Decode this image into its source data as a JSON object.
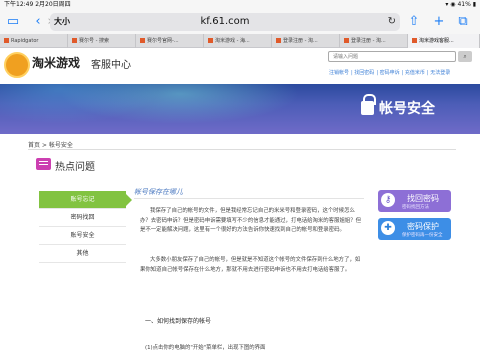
{
  "status_bar": {
    "time": "下午12:49  2月20日周四",
    "battery": "41%"
  },
  "browser": {
    "text_size_label": "大小",
    "host": "kf.61.com",
    "reload_icon": "reload-icon",
    "tabs": [
      {
        "label": "Rapidgator"
      },
      {
        "label": "赛尔号 - 搜索"
      },
      {
        "label": "赛尔号官网-..."
      },
      {
        "label": "淘米游戏 - 海..."
      },
      {
        "label": "登录注册 - 淘..."
      },
      {
        "label": "登录注册 - 淘..."
      },
      {
        "label": "淘米游戏客服..."
      }
    ]
  },
  "site": {
    "logo_text": "淘米游戏",
    "logo_sub": "客服中心",
    "search_placeholder": "请输入问题",
    "top_links": [
      "注销帐号",
      "找回密码",
      "密码申诉",
      "充值米币",
      "无法登录"
    ]
  },
  "banner": {
    "title": "帐号安全"
  },
  "breadcrumb": "首页 > 帐号安全",
  "section_title": "热点问题",
  "sidenav": [
    {
      "label": "账号忘记",
      "active": true
    },
    {
      "label": "密码找回",
      "active": false
    },
    {
      "label": "账号安全",
      "active": false
    },
    {
      "label": "其他",
      "active": false
    }
  ],
  "article": {
    "title": "帐号保存在哪儿",
    "para1": "我保存了自己的帐号的文件，但是我经常忘记自己的米米号和登录密码，这个时候怎么办？去密码申诉？但是密码申诉需要填写不少的信息才能通过，打电话给淘米的客服姐姐？但是不一定能解决问题，这里有一个很好的方法告诉你快速找到自己的帐号和登录密码。",
    "para2": "大多数小朋友保存了自己的帐号，但是就是不知道这个帐号的文件保存到什么地方了，如果你知道自己帐号保存在什么地方，那就不用去进行密码申诉也不用去打电话给客服了。",
    "heading": "一、如何找到保存的帐号",
    "step1": "(1)点击你的电脑的\"开始\"菜单栏，出现下图的界面"
  },
  "right_buttons": [
    {
      "title": "找回密码",
      "sub": "密码找回方法",
      "icon": "key-icon"
    },
    {
      "title": "密码保护",
      "sub": "保护密码再一份安全",
      "icon": "shield-icon"
    }
  ],
  "colors": {
    "accent_green": "#82c341",
    "link_blue": "#3c7fd6",
    "safari_blue": "#1a7cf5"
  }
}
